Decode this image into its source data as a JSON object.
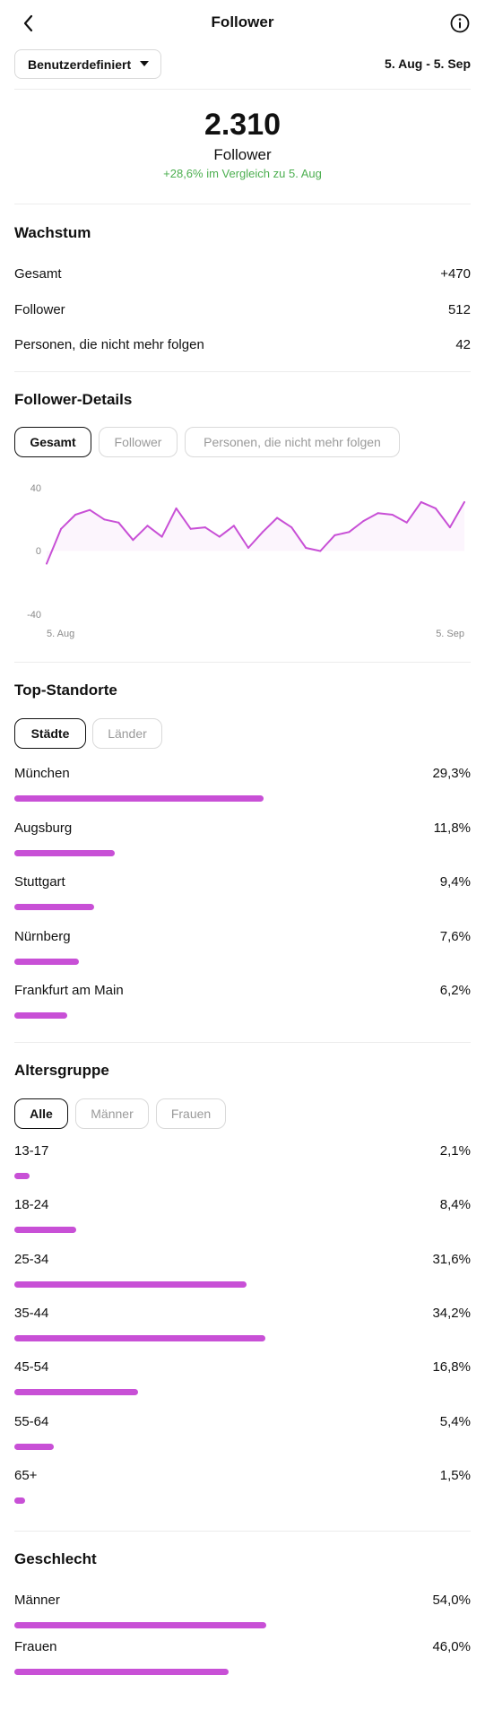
{
  "colors": {
    "accent": "#c850d6",
    "positive": "#4caf50"
  },
  "header": {
    "title": "Follower",
    "back_icon": "chevron-left-icon",
    "info_icon": "info-icon"
  },
  "filter": {
    "dropdown_label": "Benutzerdefiniert",
    "date_range": "5. Aug - 5. Sep"
  },
  "summary": {
    "count": "2.310",
    "label": "Follower",
    "change": "+28,6% im Vergleich zu 5. Aug"
  },
  "growth": {
    "title": "Wachstum",
    "rows": [
      {
        "label": "Gesamt",
        "value": "+470"
      },
      {
        "label": "Follower",
        "value": "512"
      },
      {
        "label": "Personen, die nicht mehr folgen",
        "value": "42"
      }
    ]
  },
  "details": {
    "title": "Follower-Details",
    "tabs": [
      "Gesamt",
      "Follower",
      "Personen, die nicht mehr folgen"
    ],
    "active_tab": 0
  },
  "chart_data": {
    "type": "line",
    "title": "",
    "xlabel": "",
    "ylabel": "",
    "ylim": [
      -40,
      40
    ],
    "y_ticks": [
      "40",
      "0",
      "-40"
    ],
    "x_tick_labels": [
      "5. Aug",
      "5. Sep"
    ],
    "grid": false,
    "series": [
      {
        "values": [
          -8,
          14,
          23,
          26,
          20,
          18,
          7,
          16,
          9,
          27,
          14,
          15,
          9,
          16,
          2,
          12,
          21,
          15,
          2,
          0,
          10,
          12,
          19,
          24,
          23,
          18,
          31,
          27,
          15,
          31
        ]
      }
    ]
  },
  "locations": {
    "title": "Top-Standorte",
    "tabs": [
      "Städte",
      "Länder"
    ],
    "active_tab": 0,
    "items": [
      {
        "label": "München",
        "value": "29,3%",
        "fraction": 0.293
      },
      {
        "label": "Augsburg",
        "value": "11,8%",
        "fraction": 0.118
      },
      {
        "label": "Stuttgart",
        "value": "9,4%",
        "fraction": 0.094
      },
      {
        "label": "Nürnberg",
        "value": "7,6%",
        "fraction": 0.076
      },
      {
        "label": "Frankfurt am Main",
        "value": "6,2%",
        "fraction": 0.062
      }
    ]
  },
  "age": {
    "title": "Altersgruppe",
    "tabs": [
      "Alle",
      "Männer",
      "Frauen"
    ],
    "active_tab": 0,
    "items": [
      {
        "label": "13-17",
        "value": "2,1%",
        "fraction": 0.021
      },
      {
        "label": "18-24",
        "value": "8,4%",
        "fraction": 0.084
      },
      {
        "label": "25-34",
        "value": "31,6%",
        "fraction": 0.316
      },
      {
        "label": "35-44",
        "value": "34,2%",
        "fraction": 0.342
      },
      {
        "label": "45-54",
        "value": "16,8%",
        "fraction": 0.168
      },
      {
        "label": "55-64",
        "value": "5,4%",
        "fraction": 0.054
      },
      {
        "label": "65+",
        "value": "1,5%",
        "fraction": 0.015
      }
    ]
  },
  "gender": {
    "title": "Geschlecht",
    "items": [
      {
        "label": "Männer",
        "value": "54,0%",
        "fraction": 0.54
      },
      {
        "label": "Frauen",
        "value": "46,0%",
        "fraction": 0.46
      }
    ]
  }
}
